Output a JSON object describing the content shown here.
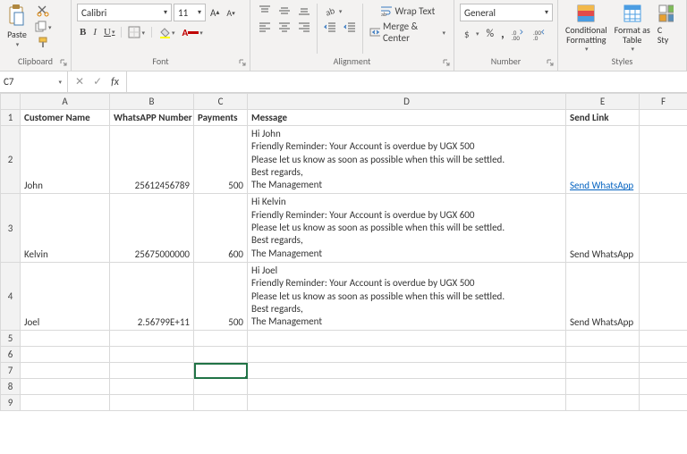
{
  "ribbon": {
    "clipboard": {
      "label": "Clipboard",
      "paste": "Paste"
    },
    "font": {
      "label": "Font",
      "name": "Calibri",
      "size": "11",
      "bold": "B",
      "italic": "I",
      "underline": "U"
    },
    "alignment": {
      "label": "Alignment",
      "wrap": "Wrap Text",
      "merge": "Merge & Center"
    },
    "number": {
      "label": "Number",
      "format": "General"
    },
    "styles": {
      "label": "Styles",
      "cond": "Conditional\nFormatting",
      "table": "Format as\nTable",
      "cell": "C\nSty"
    }
  },
  "fbar": {
    "name": "C7",
    "fx": "fx"
  },
  "columns": [
    "A",
    "B",
    "C",
    "D",
    "E",
    "F"
  ],
  "rows": [
    "1",
    "2",
    "3",
    "4",
    "5",
    "6",
    "7",
    "8",
    "9"
  ],
  "headers": {
    "a": "Customer Name",
    "b": "WhatsAPP Number",
    "c": "Payments",
    "d": "Message",
    "e": "Send Link"
  },
  "data": [
    {
      "name": "John",
      "whatsapp": "25612456789",
      "payments": "500",
      "msg": " Hi  John\n  Friendly Reminder: Your Account is overdue by UGX 500\n  Please let us know as soon as possible when this will be settled.\n Best regards,\n The Management",
      "link": "Send WhatsApp",
      "linkActive": true
    },
    {
      "name": "Kelvin",
      "whatsapp": "25675000000",
      "payments": "600",
      "msg": " Hi  Kelvin\n  Friendly Reminder: Your Account is overdue by UGX 600\n  Please let us know as soon as possible when this will be settled.\n Best regards,\n The Management",
      "link": "Send WhatsApp",
      "linkActive": false
    },
    {
      "name": "Joel",
      "whatsapp": "2.56799E+11",
      "payments": "500",
      "msg": " Hi  Joel\n  Friendly Reminder: Your Account is overdue by UGX 500\n  Please let us know as soon as possible when this will be settled.\n Best regards,\n The Management",
      "link": "Send WhatsApp",
      "linkActive": false
    }
  ]
}
